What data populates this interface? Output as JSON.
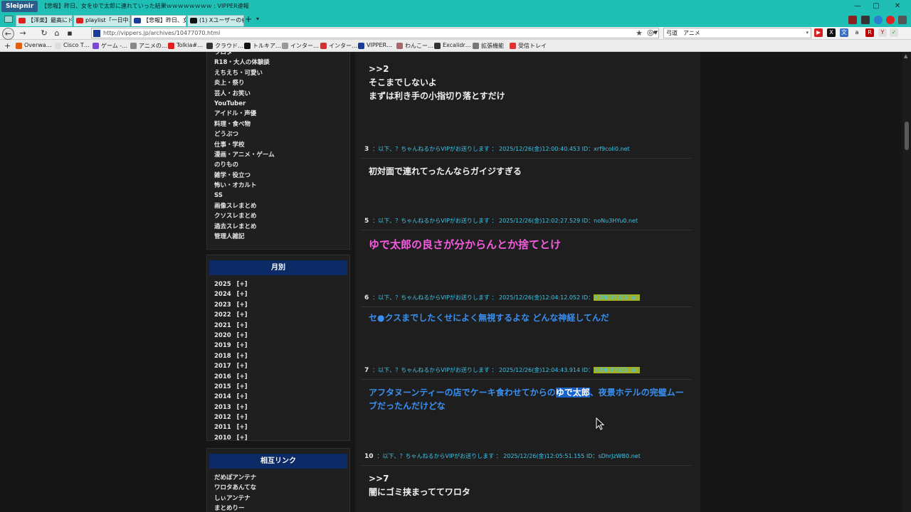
{
  "browser": {
    "brand": "Sleipnir",
    "window_title": "【悲報】昨日、女をゆで太郎に連れていった結果ｗｗｗｗｗｗｗｗ : VIPPER速報",
    "tabs": [
      {
        "label": "【洋楽】最高にド…",
        "icon": "youtube-icon"
      },
      {
        "label": "playlist「一日中…",
        "icon": "youtube-icon"
      },
      {
        "label": "【悲報】昨日、女…",
        "icon": "vipper-icon",
        "active": true
      },
      {
        "label": "(1) Xユーザーの春…",
        "icon": "x-icon"
      }
    ],
    "url": "http://vippers.jp/archives/10477070.html",
    "search_value": "弓道　アニメ",
    "bookmarks": [
      "Overwa…",
      "Cisco T…",
      "ゲーム -…",
      "アニメの…",
      "Tolkia#…",
      "クラウド…",
      "トルキア…",
      "インター…",
      "インター…",
      "VIPPER…",
      "わんこー…",
      "Excalidr…",
      "拡張機能",
      "受信トレイ"
    ]
  },
  "sidebar": {
    "categories": [
      "ワロタ",
      "R18・大人の体験談",
      "えちえち・可愛い",
      "炎上・祭り",
      "芸人・お笑い",
      "YouTuber",
      "アイドル・声優",
      "料理・食べ物",
      "どうぶつ",
      "仕事・学校",
      "漫画・アニメ・ゲーム",
      "のりもの",
      "雑学・役立つ",
      "怖い・オカルト",
      "SS",
      "画像スレまとめ",
      "クソスレまとめ",
      "過去スレまとめ",
      "管理人雑記"
    ],
    "monthly": {
      "heading": "月別",
      "toggle": "[+]",
      "years": [
        "2025",
        "2024",
        "2023",
        "2022",
        "2021",
        "2020",
        "2019",
        "2018",
        "2017",
        "2016",
        "2015",
        "2014",
        "2013",
        "2012",
        "2011",
        "2010"
      ]
    },
    "links": {
      "heading": "相互リンク",
      "items": [
        "だめぽアンテナ",
        "ワロタあんてな",
        "しぃアンテナ",
        "まとめりー"
      ]
    }
  },
  "posts": [
    {
      "meta": "",
      "lines": [
        ">>2",
        "そこまでしないよ",
        "まずは利き手の小指切り落とすだけ"
      ],
      "style": "white"
    },
    {
      "num": "3",
      "meta": "：以下、？ちゃんねるからVIPがお送りします ： 2025/12/26(金)12:00:40.453 ID：",
      "id": "xrf9coIi0.net",
      "lines": [
        "初対面で連れてったんならガイジすぎる"
      ],
      "style": "white"
    },
    {
      "num": "5",
      "meta": "：以下、？ちゃんねるからVIPがお送りします ： 2025/12/26(金)12:02:27.529 ID：",
      "id": "noNu3HYu0.net",
      "lines": [
        "ゆで太郎の良さが分からんとか捨てとけ"
      ],
      "style": "pink"
    },
    {
      "num": "6",
      "meta": "：以下、？ちゃんねるからVIPがお送りします ： 2025/12/26(金)12:04:12.052 ID：",
      "id": "V2Nk8Y9Z0.net",
      "id_highlight": true,
      "lines": [
        "セ●クスまでしたくせによく無視するよな どんな神経してんだ"
      ],
      "style": "blue"
    },
    {
      "num": "7",
      "meta": "：以下、？ちゃんねるからVIPがお送りします ： 2025/12/26(金)12:04:43.914 ID：",
      "id": "V2Nk8Y9Z0.net",
      "id_highlight": true,
      "line_before": "アフタヌーンティーの店でケーキ食わせてからの",
      "selected": "ゆで太郎",
      "line_after": "、夜景ホテルの完璧ムー",
      "line2": "ブだったんだけどな",
      "style": "blue"
    },
    {
      "num": "10",
      "meta": "：以下、？ちゃんねるからVIPがお送りします ： 2025/12/26(金)12:05:51.155 ID：",
      "id": "sDhrJzWB0.net",
      "lines": [
        ">>7",
        "闇にゴミ挟まっててワロタ"
      ],
      "style": "white"
    }
  ],
  "colors": {
    "titlebar": "#1fbfb6",
    "sidebar_head": "#0c2a66",
    "meta": "#3fc4e8",
    "pink": "#f45ce0",
    "blue": "#3a8ff0",
    "id_highlight": "#a3b024"
  }
}
